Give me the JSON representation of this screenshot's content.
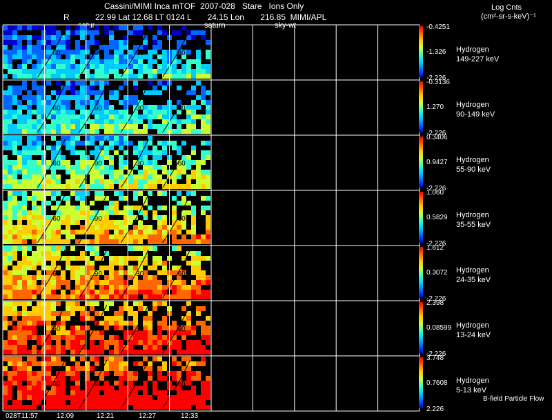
{
  "header": {
    "line1": "Cassini/MIMI Inca mTOF  2007-028   Stare   Ions Only",
    "r_label": "R",
    "line2": "22.99 Lat 12.68 LT 0124 L       24.15 Lon       216.85  MIMI/APL",
    "overlay_a": "satur",
    "overlay_b": "saturn",
    "overlay_c": "sky-wt",
    "units_title": "Log Cnts",
    "units": "(cm²-sr-s-keV)⁻¹"
  },
  "footer": {
    "legend": "B-field Particle Flow"
  },
  "chart_data": {
    "type": "heatmap",
    "columns": 10,
    "filled_columns": 5,
    "time_labels": [
      "028T11:57",
      "12:09",
      "12:21",
      "12:27",
      "12:33"
    ],
    "contour_labels": [
      "30",
      "60",
      "90"
    ],
    "colorscale": [
      "#0000cc",
      "#0066ff",
      "#00ccff",
      "#33ffcc",
      "#ccff33",
      "#ffcc00",
      "#ff6600",
      "#ff0000"
    ],
    "panels": [
      {
        "species": "Hydrogen",
        "energy": "149-227 keV",
        "max": "-0.4251",
        "mid": "-1.326",
        "min": "-2.226",
        "level": 0.12
      },
      {
        "species": "Hydrogen",
        "energy": "90-149 keV",
        "max": "-0.3136",
        "mid": "1.270",
        "min": "-2.226",
        "level": 0.18
      },
      {
        "species": "Hydrogen",
        "energy": "55-90 keV",
        "max": "0.3406",
        "mid": "0.9427",
        "min": "-2.226",
        "level": 0.3
      },
      {
        "species": "Hydrogen",
        "energy": "35-55 keV",
        "max": "1.060",
        "mid": "0.5829",
        "min": "-2.226",
        "level": 0.45
      },
      {
        "species": "Hydrogen",
        "energy": "24-35 keV",
        "max": "1.612",
        "mid": "0.3072",
        "min": "-2.226",
        "level": 0.55
      },
      {
        "species": "Hydrogen",
        "energy": "13-24 keV",
        "max": "2.398",
        "mid": "0.08599",
        "min": "-2.226",
        "level": 0.68
      },
      {
        "species": "Hydrogen",
        "energy": "5-13 keV",
        "max": "3.748",
        "mid": "0.7608",
        "min": "2.226",
        "level": 0.78
      }
    ]
  }
}
